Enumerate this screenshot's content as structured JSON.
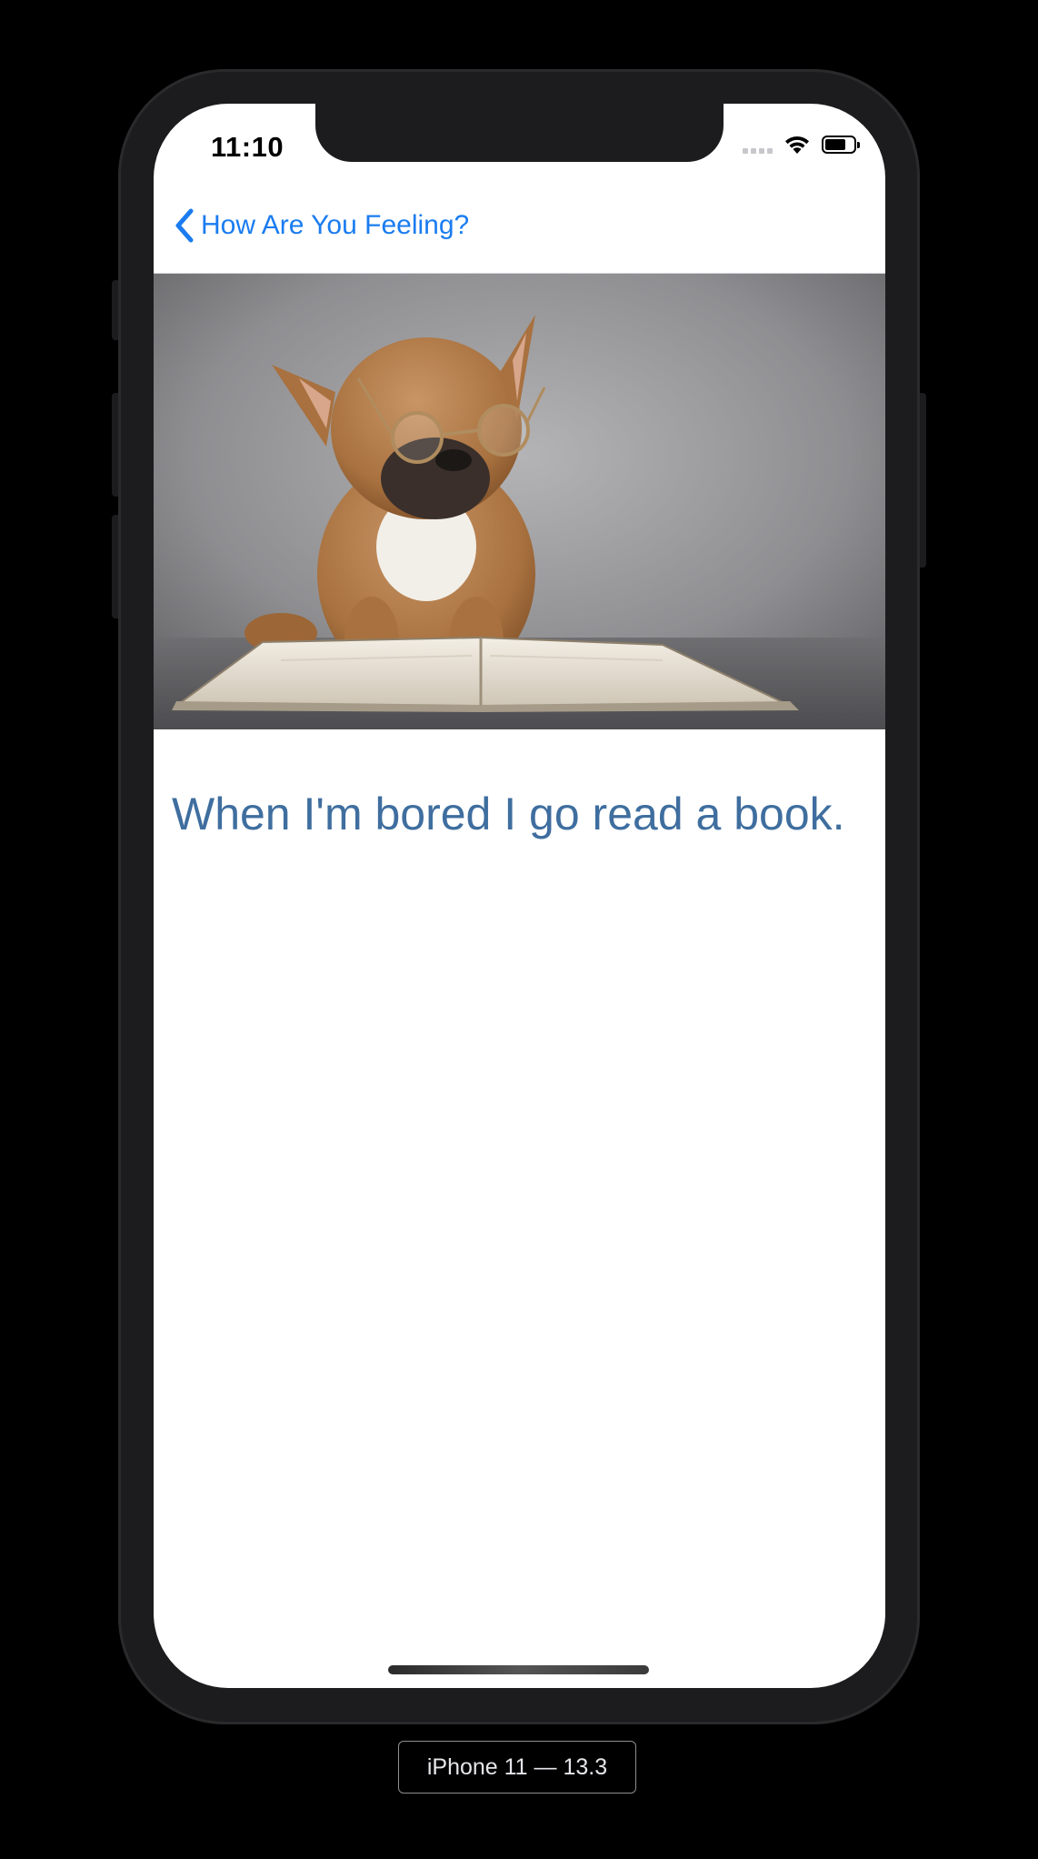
{
  "status_bar": {
    "time": "11:10",
    "icons": [
      "cellular-signal-icon",
      "wifi-icon",
      "battery-icon"
    ]
  },
  "nav": {
    "back_label": "How Are You Feeling?",
    "back_icon": "chevron-left-icon"
  },
  "content": {
    "image_subject": "dog-reading-book-photo",
    "caption": "When I'm bored I go read a book."
  },
  "simulator": {
    "device_label": "iPhone 11 — 13.3"
  },
  "colors": {
    "tint": "#1a7cf0",
    "caption": "#3f6e9f",
    "device_frame": "#1c1c1e",
    "background": "#000000"
  }
}
